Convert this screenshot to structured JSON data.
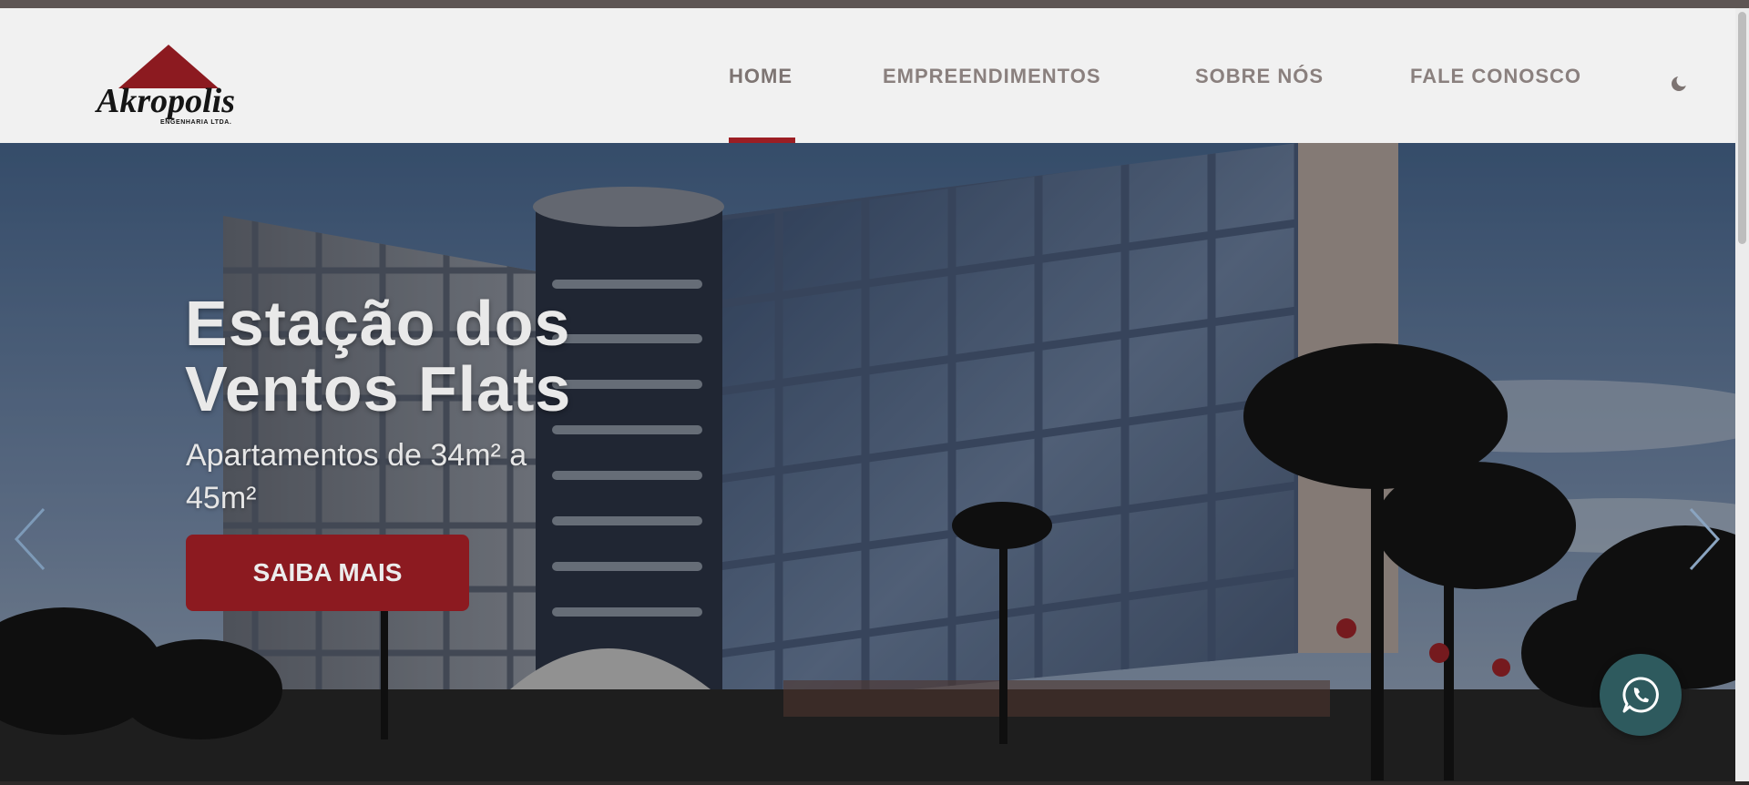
{
  "brand": {
    "name": "Akropolis",
    "tagline": "ENGENHARIA LTDA."
  },
  "nav": {
    "items": [
      {
        "label": "HOME",
        "active": true
      },
      {
        "label": "EMPREENDIMENTOS",
        "active": false
      },
      {
        "label": "SOBRE NÓS",
        "active": false
      },
      {
        "label": "FALE CONOSCO",
        "active": false
      }
    ],
    "theme_toggle_icon": "moon-icon"
  },
  "hero": {
    "title_line1": "Estação dos",
    "title_line2": "Ventos Flats",
    "subtitle": "Apartamentos de 34m² a 45m²",
    "cta_label": "SAIBA MAIS",
    "prev_icon": "chevron-left-icon",
    "next_icon": "chevron-right-icon"
  },
  "floating": {
    "whatsapp_icon": "whatsapp-icon"
  },
  "colors": {
    "accent": "#9c1e24",
    "button": "#8c1a20",
    "header_bg": "#f1f1f1",
    "nav_text": "#8a807e",
    "whatsapp_bg": "#2e5a5e"
  }
}
